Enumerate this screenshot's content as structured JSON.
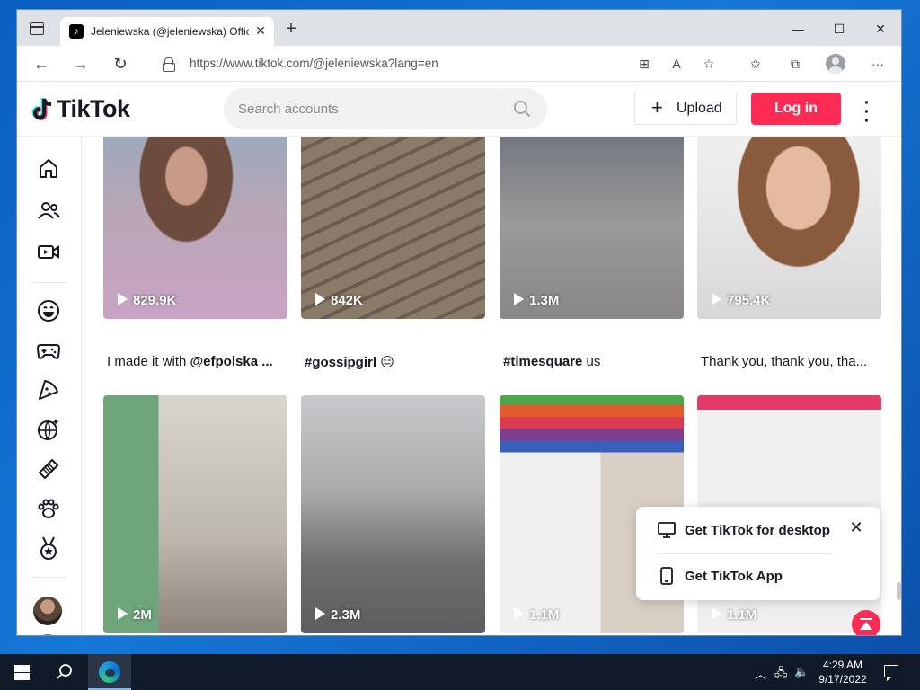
{
  "browser": {
    "tab_title": "Jeleniewska (@jeleniewska) Official TikTok",
    "tab_favicon": "tiktok-icon",
    "url": "https://www.tiktok.com/@jeleniewska?lang=en",
    "window_buttons": {
      "minimize": "—",
      "maximize": "☐",
      "close": "✕"
    }
  },
  "header": {
    "logo_text": "TikTok",
    "search_placeholder": "Search accounts",
    "upload_label": "Upload",
    "login_label": "Log in"
  },
  "sidebar": {
    "icons": [
      "home-icon",
      "following-icon",
      "live-icon",
      "comedy-icon",
      "gaming-icon",
      "food-icon",
      "dance-icon",
      "beauty-icon",
      "animals-icon",
      "sports-icon"
    ]
  },
  "videos": [
    {
      "views": "829.9K",
      "caption_plain": "I made it with ",
      "caption_bold": "@efpolska ...",
      "caption_tail": ""
    },
    {
      "views": "842K",
      "caption_plain": "",
      "caption_bold": "#gossipgirl",
      "caption_tail": " 😑"
    },
    {
      "views": "1.3M",
      "caption_plain": "",
      "caption_bold": "#timesquare",
      "caption_tail": " us"
    },
    {
      "views": "795.4K",
      "caption_plain": "Thank you, thank you, tha...",
      "caption_bold": "",
      "caption_tail": ""
    },
    {
      "views": "2M"
    },
    {
      "views": "2.3M"
    },
    {
      "views": "1.1M"
    },
    {
      "views": "1.1M"
    }
  ],
  "popup": {
    "desktop_label": "Get TikTok for desktop",
    "app_label": "Get TikTok App"
  },
  "taskbar": {
    "time": "4:29 AM",
    "date": "9/17/2022"
  },
  "colors": {
    "accent": "#fe2c55",
    "text": "#161823"
  }
}
